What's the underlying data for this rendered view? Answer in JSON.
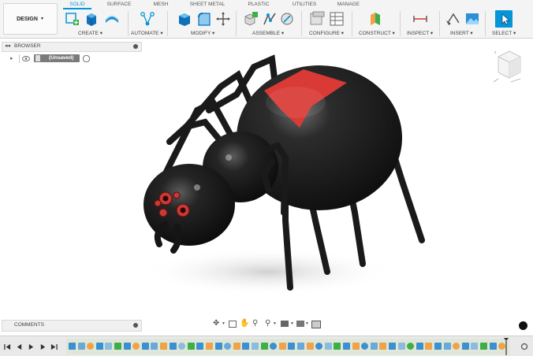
{
  "toolbar": {
    "design_label": "DESIGN",
    "tabs": [
      "SOLID",
      "SURFACE",
      "MESH",
      "SHEET METAL",
      "PLASTIC",
      "UTILITIES",
      "MANAGE"
    ],
    "active_tab": "SOLID",
    "groups": [
      "CREATE",
      "AUTOMATE",
      "MODIFY",
      "ASSEMBLE",
      "CONFIGURE",
      "CONSTRUCT",
      "INSPECT",
      "INSERT",
      "SELECT"
    ],
    "accent_color": "#0696d7"
  },
  "browser": {
    "title": "BROWSER",
    "root_item": "(Unsaved)"
  },
  "comments": {
    "title": "COMMENTS"
  },
  "icons": {
    "browser_collapse": "double-chevron-left-icon",
    "panel_close": "panel-dot-icon",
    "eye": "eye-icon",
    "doc": "document-icon",
    "record": "record-icon",
    "viewcube": "viewcube-icon",
    "orbit": "orbit-icon",
    "pan": "pan-hand-icon",
    "zoom": "zoom-icon",
    "display": "display-settings-icon",
    "grid": "grid-icon",
    "viewports": "viewports-icon",
    "chat": "chat-icon"
  },
  "model": {
    "body_color": "#1c1c1c",
    "marking_color": "#d93a36"
  }
}
